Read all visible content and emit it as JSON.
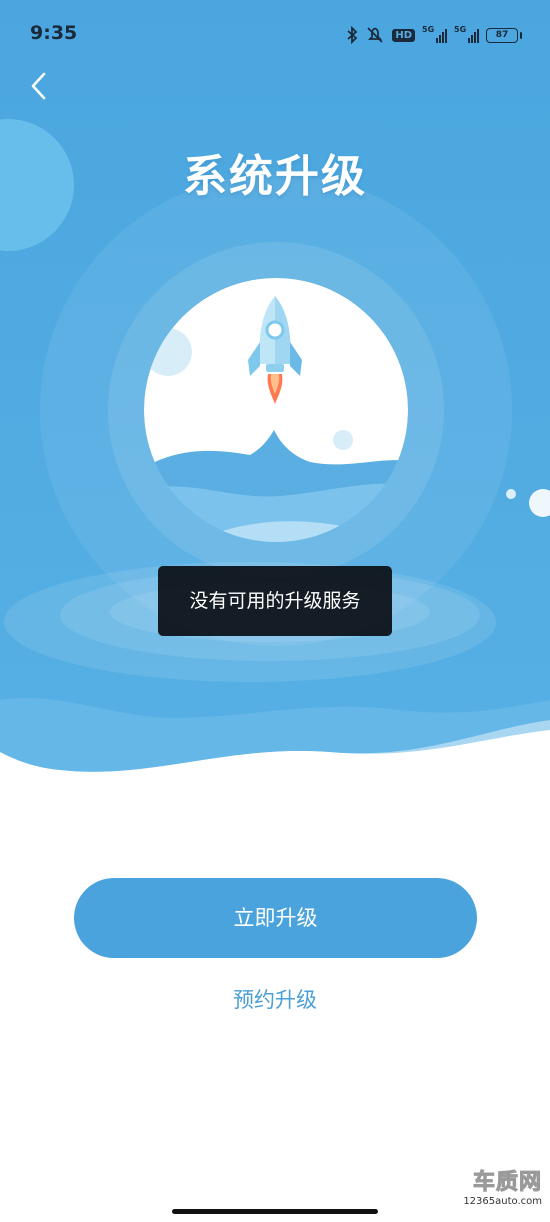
{
  "status_bar": {
    "time": "9:35",
    "icons": [
      "bluetooth-icon",
      "mute-icon",
      "hd-badge",
      "signal-5g-1-icon",
      "signal-5g-2-icon",
      "battery-icon"
    ],
    "hd_label": "HD",
    "network_1": "5G",
    "network_2": "5G",
    "battery": "87"
  },
  "header": {
    "back_icon": "chevron-left-icon",
    "title": "系统升级"
  },
  "illustration": {
    "icon": "rocket-icon"
  },
  "toast": {
    "message": "没有可用的升级服务"
  },
  "actions": {
    "upgrade_now": "立即升级",
    "schedule_upgrade": "预约升级"
  },
  "watermark": {
    "brand": "车质网",
    "url": "12365auto.com"
  },
  "colors": {
    "hero_blue": "#4ea8df",
    "button_blue": "#4aa3dd",
    "link_blue": "#4a9fd6",
    "toast_bg": "#0a0e14"
  }
}
